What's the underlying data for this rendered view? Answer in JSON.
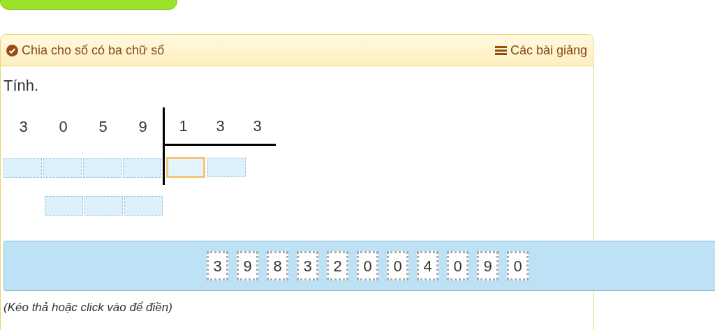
{
  "header": {
    "title": "Chia cho số có ba chữ số",
    "lessons_link": "Các bài giảng"
  },
  "prompt": "Tính.",
  "division": {
    "dividend": [
      "3",
      "0",
      "5",
      "9"
    ],
    "divisor": [
      "1",
      "3",
      "3"
    ],
    "work_rows": [
      {
        "cells": [
          {
            "selected": false
          },
          {
            "selected": false
          },
          {
            "selected": false
          },
          {
            "selected": false
          }
        ]
      },
      {
        "cells": [
          {
            "selected": false
          },
          {
            "selected": false
          },
          {
            "selected": false
          }
        ]
      }
    ],
    "quotient_cells": [
      {
        "selected": true
      },
      {
        "selected": false
      }
    ]
  },
  "tiles": [
    "3",
    "9",
    "8",
    "3",
    "2",
    "0",
    "0",
    "4",
    "0",
    "9",
    "0"
  ],
  "hint": "(Kéo thả hoặc click vào để điền)"
}
